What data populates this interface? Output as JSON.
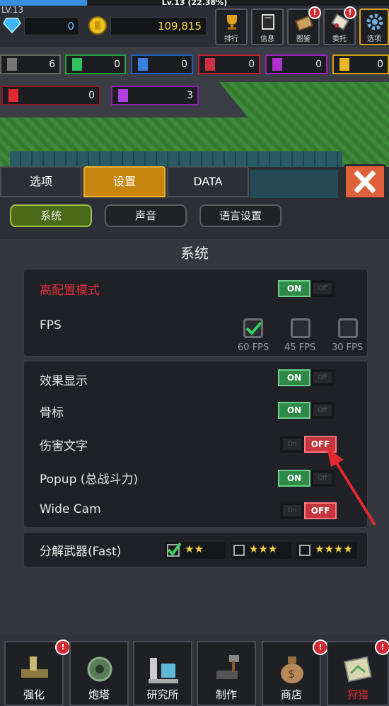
{
  "top": {
    "level_short": "LV.13",
    "xp_text": "Lv.13 (22.38%)",
    "xp_progress": 0.2238,
    "diamonds": "0",
    "gold": "109,815",
    "buttons": [
      {
        "id": "rank",
        "label": "排行",
        "alert": false
      },
      {
        "id": "info",
        "label": "信息",
        "alert": false
      },
      {
        "id": "codex",
        "label": "图鉴",
        "alert": true
      },
      {
        "id": "commission",
        "label": "委托",
        "alert": true
      },
      {
        "id": "options",
        "label": "选项",
        "alert": false
      }
    ]
  },
  "resources": [
    {
      "color": "gray",
      "value": "6"
    },
    {
      "color": "green",
      "value": "0"
    },
    {
      "color": "blue",
      "value": "0"
    },
    {
      "color": "red",
      "value": "0"
    },
    {
      "color": "purple",
      "value": "0"
    },
    {
      "color": "yellow",
      "value": "0"
    },
    {
      "color": "crimson",
      "value": "0"
    },
    {
      "color": "violet",
      "value": "3"
    }
  ],
  "tabs": [
    "选项",
    "设置",
    "DATA"
  ],
  "active_tab": "设置",
  "subtabs": [
    "系统",
    "声音",
    "语言设置"
  ],
  "active_subtab": "系统",
  "section_title": "系统",
  "settings": {
    "high_config_label": "高配置模式",
    "fps_label": "FPS",
    "fps_options": [
      "60 FPS",
      "45 FPS",
      "30 FPS"
    ],
    "fps_selected": "60 FPS",
    "toggles": [
      {
        "label": "效果显示",
        "state": "ON"
      },
      {
        "label": "骨标",
        "state": "ON"
      },
      {
        "label": "伤害文字",
        "state": "OFF"
      },
      {
        "label": "Popup (总战斗力)",
        "state": "ON"
      },
      {
        "label": "Wide Cam",
        "state": "OFF"
      }
    ],
    "on_text": "ON",
    "off_text": "OFF",
    "on_dim": "On",
    "off_dim": "Off",
    "disassemble_label": "分解武器(Fast)",
    "disassemble_options": [
      {
        "stars": "★★",
        "checked": true
      },
      {
        "stars": "★★★",
        "checked": false
      },
      {
        "stars": "★★★★",
        "checked": false
      }
    ]
  },
  "bottom_nav": [
    {
      "label": "强化",
      "alert": true
    },
    {
      "label": "炮塔",
      "alert": false
    },
    {
      "label": "研究所",
      "alert": false
    },
    {
      "label": "制作",
      "alert": false
    },
    {
      "label": "商店",
      "alert": true
    },
    {
      "label": "狩猎",
      "alert": true
    }
  ],
  "alert_glyph": "!",
  "colors": {
    "accent_tab": "#c8860f",
    "on": "#2f8a48",
    "off": "#c8343e",
    "alert": "#d02a34",
    "close": "#e0603a",
    "high_config_text": "#e0303a"
  }
}
